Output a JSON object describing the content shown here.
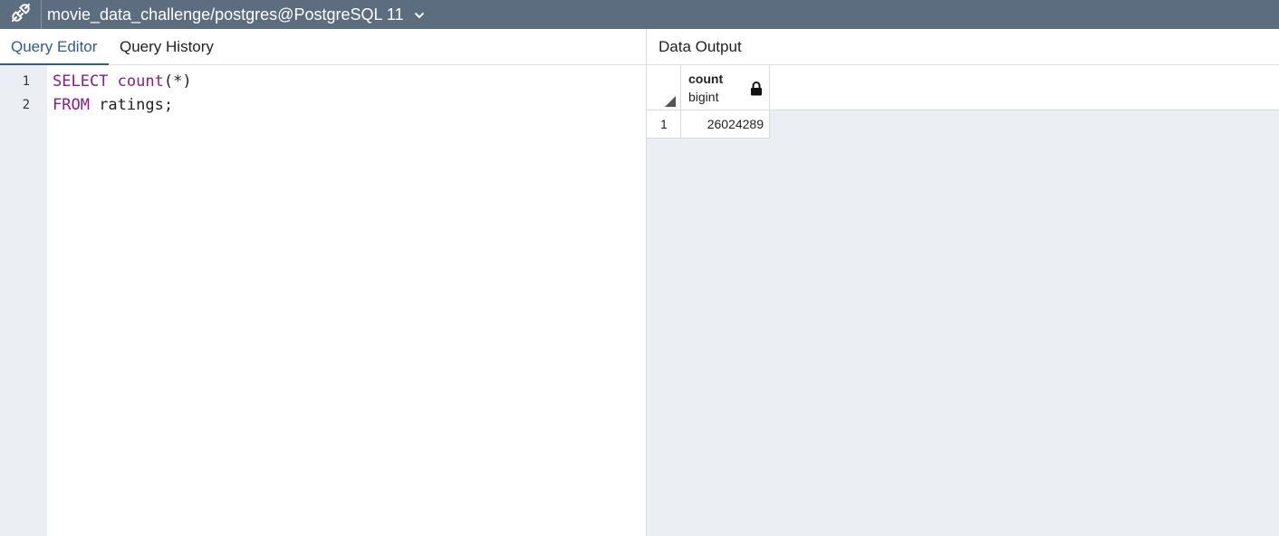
{
  "topbar": {
    "connection_title": "movie_data_challenge/postgres@PostgreSQL 11",
    "icon": "plug-connection-icon",
    "dropdown_icon": "chevron-down-icon"
  },
  "editor": {
    "tabs": [
      {
        "label": "Query Editor",
        "active": true
      },
      {
        "label": "Query History",
        "active": false
      }
    ],
    "lines": [
      {
        "number": "1",
        "tokens": [
          {
            "text": "SELECT",
            "kw": true
          },
          {
            "text": " "
          },
          {
            "text": "count",
            "kw": true
          },
          {
            "text": "(*)"
          }
        ]
      },
      {
        "number": "2",
        "tokens": [
          {
            "text": "FROM",
            "kw": true
          },
          {
            "text": " ratings;"
          }
        ]
      }
    ]
  },
  "output": {
    "tab_label": "Data Output",
    "columns": [
      {
        "name": "count",
        "type": "bigint",
        "icon": "lock-icon"
      }
    ],
    "rows": [
      {
        "row_number": "1",
        "values": [
          "26024289"
        ]
      }
    ]
  },
  "colors": {
    "topbar_bg": "#5b6d7e",
    "active_tab": "#2c5d94",
    "keyword": "#8a1c8a",
    "gutter_bg": "#ebeef3",
    "grid_bg": "#ebeef2"
  }
}
